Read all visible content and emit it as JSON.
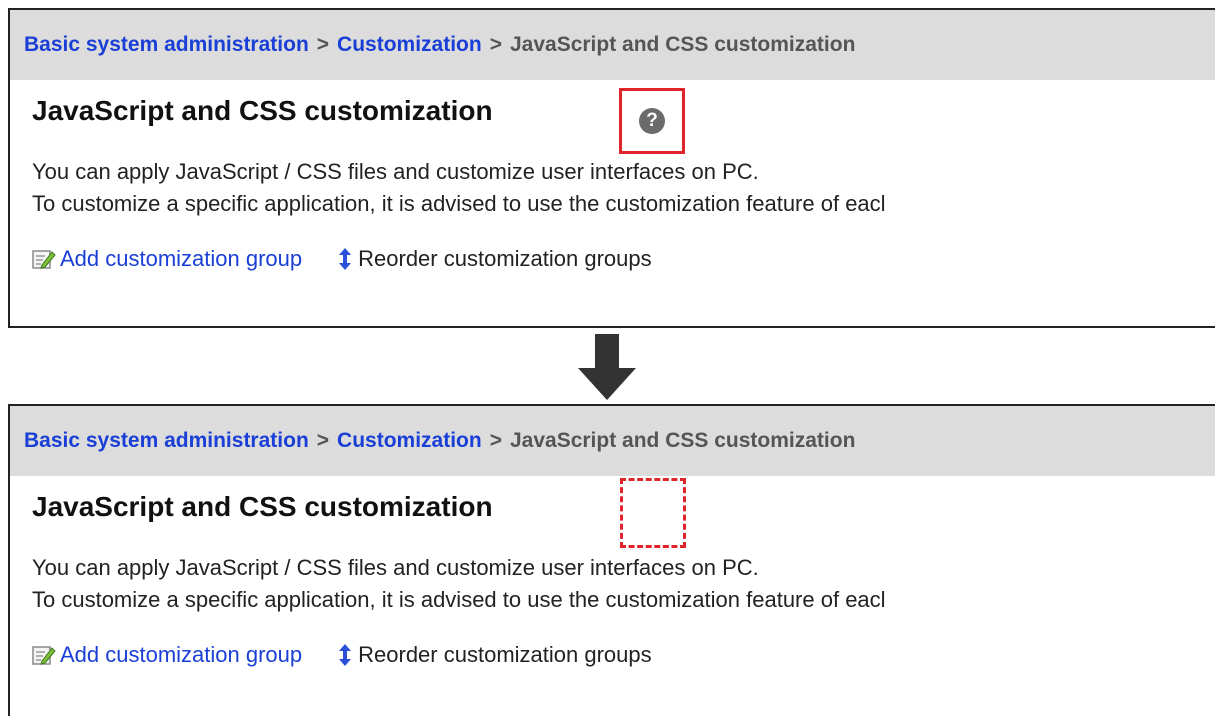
{
  "breadcrumb": {
    "item1": "Basic system administration",
    "separator": ">",
    "item2": "Customization",
    "current": "JavaScript and CSS customization"
  },
  "page": {
    "title": "JavaScript and CSS customization",
    "help_glyph": "?",
    "description_line1": "You can apply JavaScript / CSS files and customize user interfaces on PC.",
    "description_line2": "To customize a specific application, it is advised to use the customization feature of eacl"
  },
  "actions": {
    "add_group": "Add customization group",
    "reorder_groups": "Reorder customization groups"
  },
  "icons": {
    "add": "edit-note-icon",
    "reorder": "up-down-arrow-icon",
    "help": "question-circle-icon",
    "transition": "arrow-down-icon"
  },
  "colors": {
    "link": "#1a3fd6",
    "highlight": "#e0242c",
    "header_bg": "#dcdcdc"
  }
}
